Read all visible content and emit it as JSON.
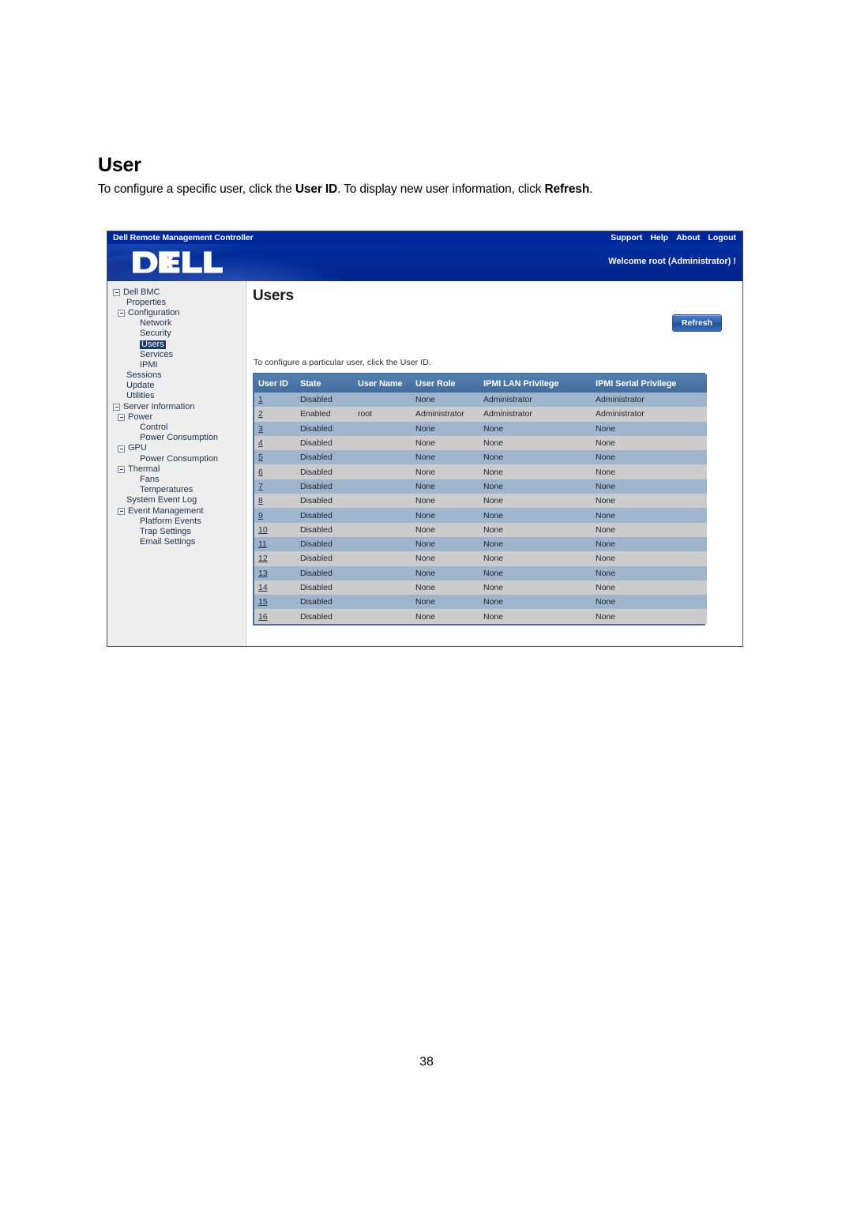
{
  "document": {
    "title": "User",
    "subtitle_parts": [
      {
        "text": "To configure a specific user, click the ",
        "bold": false
      },
      {
        "text": "User ID",
        "bold": true
      },
      {
        "text": ". To display new user information, click ",
        "bold": false
      },
      {
        "text": "Refresh",
        "bold": true
      },
      {
        "text": ".",
        "bold": false
      }
    ],
    "subtitle_plain": "To configure a specific user, click the User ID. To display new user information, click Refresh.",
    "page_number": "38"
  },
  "app": {
    "titlebar": {
      "product": "Dell Remote Management Controller",
      "links": [
        {
          "label": "Support"
        },
        {
          "label": "Help"
        },
        {
          "label": "About"
        },
        {
          "label": "Logout"
        }
      ]
    },
    "banner": {
      "logo_text": "DELL",
      "welcome": "Welcome root (Administrator) !"
    },
    "colors": {
      "banner_blue": "#00269b",
      "header_row": "#4a77a8",
      "row_odd": "#9eb5cd",
      "row_even": "#cccccc",
      "selected_nav": "#1b3a6b",
      "table_border": "#4a6f9e"
    }
  },
  "sidebar": {
    "items": [
      {
        "label": "Dell BMC",
        "level": 0,
        "expander": true,
        "selected": false
      },
      {
        "label": "Properties",
        "level": 1,
        "expander": false,
        "selected": false
      },
      {
        "label": "Configuration",
        "level": 1,
        "expander": true,
        "selected": false
      },
      {
        "label": "Network",
        "level": 2,
        "expander": false,
        "selected": false
      },
      {
        "label": "Security",
        "level": 2,
        "expander": false,
        "selected": false
      },
      {
        "label": "Users",
        "level": 2,
        "expander": false,
        "selected": true
      },
      {
        "label": "Services",
        "level": 2,
        "expander": false,
        "selected": false
      },
      {
        "label": "IPMI",
        "level": 2,
        "expander": false,
        "selected": false
      },
      {
        "label": "Sessions",
        "level": 1,
        "expander": false,
        "selected": false
      },
      {
        "label": "Update",
        "level": 1,
        "expander": false,
        "selected": false
      },
      {
        "label": "Utilities",
        "level": 1,
        "expander": false,
        "selected": false
      },
      {
        "label": "Server Information",
        "level": 0,
        "expander": true,
        "selected": false
      },
      {
        "label": "Power",
        "level": 1,
        "expander": true,
        "selected": false
      },
      {
        "label": "Control",
        "level": 2,
        "expander": false,
        "selected": false
      },
      {
        "label": "Power Consumption",
        "level": 2,
        "expander": false,
        "selected": false
      },
      {
        "label": "GPU",
        "level": 1,
        "expander": true,
        "selected": false
      },
      {
        "label": "Power Consumption",
        "level": 2,
        "expander": false,
        "selected": false
      },
      {
        "label": "Thermal",
        "level": 1,
        "expander": true,
        "selected": false
      },
      {
        "label": "Fans",
        "level": 2,
        "expander": false,
        "selected": false
      },
      {
        "label": "Temperatures",
        "level": 2,
        "expander": false,
        "selected": false
      },
      {
        "label": "System Event Log",
        "level": 1,
        "expander": false,
        "selected": false
      },
      {
        "label": "Event Management",
        "level": 1,
        "expander": true,
        "selected": false
      },
      {
        "label": "Platform Events",
        "level": 2,
        "expander": false,
        "selected": false
      },
      {
        "label": "Trap Settings",
        "level": 2,
        "expander": false,
        "selected": false
      },
      {
        "label": "Email Settings",
        "level": 2,
        "expander": false,
        "selected": false
      }
    ]
  },
  "main": {
    "heading": "Users",
    "refresh_label": "Refresh",
    "hint": "To configure a particular user, click the User ID.",
    "table": {
      "columns": [
        "User ID",
        "State",
        "User Name",
        "User Role",
        "IPMI LAN Privilege",
        "IPMI Serial Privilege"
      ],
      "rows": [
        {
          "id": "1",
          "state": "Disabled",
          "name": "",
          "role": "None",
          "lan": "Administrator",
          "serial": "Administrator"
        },
        {
          "id": "2",
          "state": "Enabled",
          "name": "root",
          "role": "Administrator",
          "lan": "Administrator",
          "serial": "Administrator"
        },
        {
          "id": "3",
          "state": "Disabled",
          "name": "",
          "role": "None",
          "lan": "None",
          "serial": "None"
        },
        {
          "id": "4",
          "state": "Disabled",
          "name": "",
          "role": "None",
          "lan": "None",
          "serial": "None"
        },
        {
          "id": "5",
          "state": "Disabled",
          "name": "",
          "role": "None",
          "lan": "None",
          "serial": "None"
        },
        {
          "id": "6",
          "state": "Disabled",
          "name": "",
          "role": "None",
          "lan": "None",
          "serial": "None"
        },
        {
          "id": "7",
          "state": "Disabled",
          "name": "",
          "role": "None",
          "lan": "None",
          "serial": "None"
        },
        {
          "id": "8",
          "state": "Disabled",
          "name": "",
          "role": "None",
          "lan": "None",
          "serial": "None"
        },
        {
          "id": "9",
          "state": "Disabled",
          "name": "",
          "role": "None",
          "lan": "None",
          "serial": "None"
        },
        {
          "id": "10",
          "state": "Disabled",
          "name": "",
          "role": "None",
          "lan": "None",
          "serial": "None"
        },
        {
          "id": "11",
          "state": "Disabled",
          "name": "",
          "role": "None",
          "lan": "None",
          "serial": "None"
        },
        {
          "id": "12",
          "state": "Disabled",
          "name": "",
          "role": "None",
          "lan": "None",
          "serial": "None"
        },
        {
          "id": "13",
          "state": "Disabled",
          "name": "",
          "role": "None",
          "lan": "None",
          "serial": "None"
        },
        {
          "id": "14",
          "state": "Disabled",
          "name": "",
          "role": "None",
          "lan": "None",
          "serial": "None"
        },
        {
          "id": "15",
          "state": "Disabled",
          "name": "",
          "role": "None",
          "lan": "None",
          "serial": "None"
        },
        {
          "id": "16",
          "state": "Disabled",
          "name": "",
          "role": "None",
          "lan": "None",
          "serial": "None"
        }
      ]
    }
  }
}
